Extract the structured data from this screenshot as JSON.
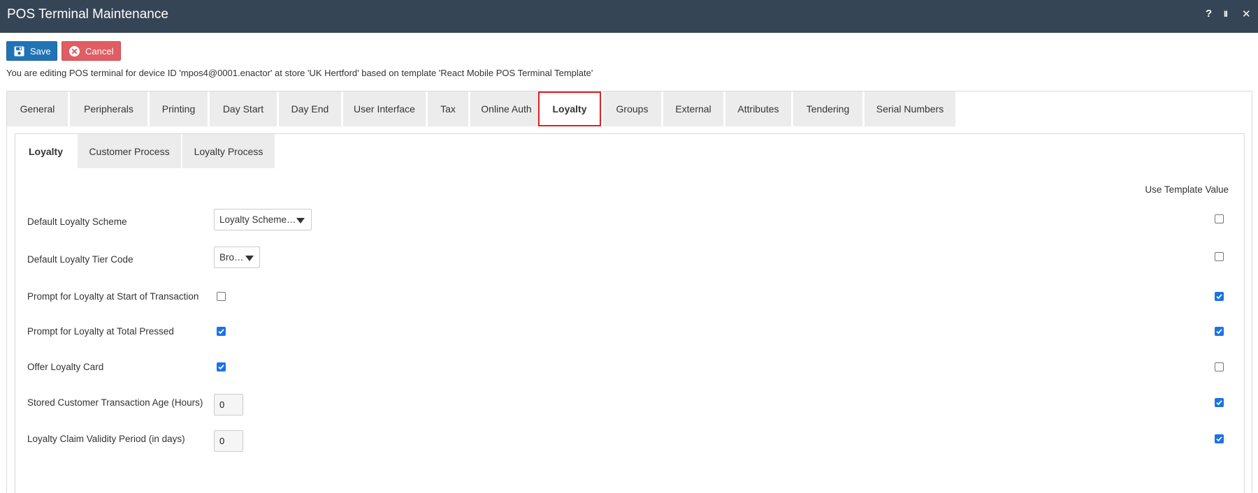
{
  "window": {
    "title": "POS Terminal Maintenance",
    "help_label": "?",
    "pause_label": "II",
    "close_label": "✕"
  },
  "toolbar": {
    "save_label": "Save",
    "cancel_label": "Cancel"
  },
  "info_text": "You are editing POS terminal for device ID 'mpos4@0001.enactor' at store 'UK Hertford' based on template 'React Mobile POS Terminal Template'",
  "tabs": [
    {
      "label": "General"
    },
    {
      "label": "Peripherals"
    },
    {
      "label": "Printing"
    },
    {
      "label": "Day Start"
    },
    {
      "label": "Day End"
    },
    {
      "label": "User Interface"
    },
    {
      "label": "Tax"
    },
    {
      "label": "Online Auth"
    },
    {
      "label": "Loyalty",
      "active": true
    },
    {
      "label": "Groups"
    },
    {
      "label": "External"
    },
    {
      "label": "Attributes"
    },
    {
      "label": "Tendering"
    },
    {
      "label": "Serial Numbers"
    }
  ],
  "subtabs": [
    {
      "label": "Loyalty",
      "active": true
    },
    {
      "label": "Customer Process"
    },
    {
      "label": "Loyalty Process"
    }
  ],
  "template_header": "Use Template Value",
  "fields": {
    "default_loyalty_scheme": {
      "label": "Default Loyalty Scheme",
      "value": "Loyalty Scheme…",
      "use_template": false
    },
    "default_loyalty_tier_code": {
      "label": "Default Loyalty Tier Code",
      "value": "Bro…",
      "use_template": false
    },
    "prompt_start": {
      "label": "Prompt for Loyalty at Start of Transaction",
      "checked": false,
      "use_template": true
    },
    "prompt_total": {
      "label": "Prompt for Loyalty at Total Pressed",
      "checked": true,
      "use_template": true
    },
    "offer_card": {
      "label": "Offer Loyalty Card",
      "checked": true,
      "use_template": false
    },
    "stored_age": {
      "label": "Stored Customer Transaction Age (Hours)",
      "value": "0",
      "use_template": true
    },
    "claim_validity": {
      "label": "Loyalty Claim Validity Period (in days)",
      "value": "0",
      "use_template": true
    }
  },
  "colors": {
    "titlebar": "#364555",
    "save": "#2074b6",
    "cancel": "#e05d64",
    "active_tab_border": "#e02020",
    "checkbox_checked": "#1a73e8"
  }
}
